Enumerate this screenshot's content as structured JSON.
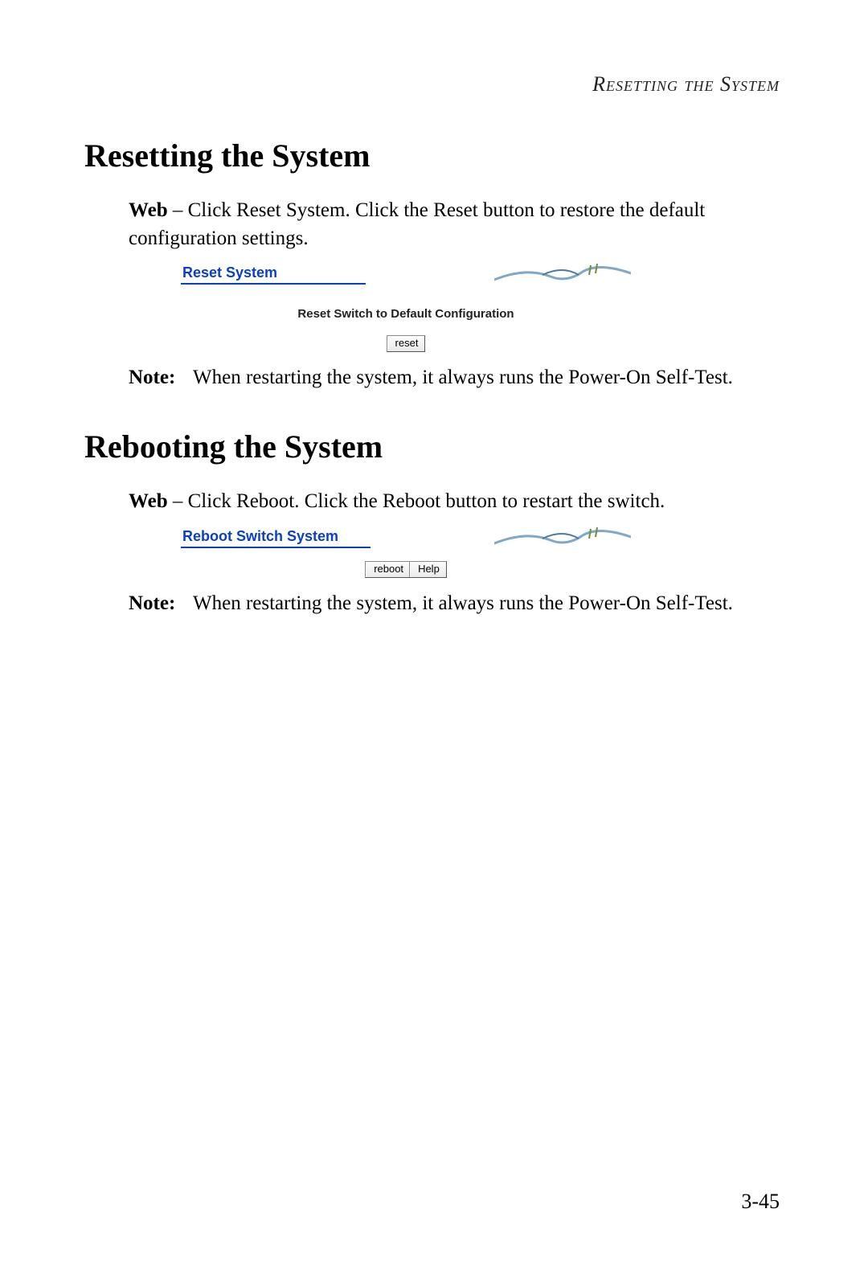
{
  "running_head": "Resetting the System",
  "page_number": "3-45",
  "section1": {
    "heading": "Resetting the System",
    "lead_bold": "Web",
    "lead_rest": " – Click Reset System. Click the Reset button to restore the default configuration settings.",
    "ui": {
      "title": "Reset System",
      "subhead": "Reset Switch to Default Configuration",
      "buttons": {
        "reset": "reset"
      }
    },
    "note_label": "Note:",
    "note_text": "When restarting the system, it always runs the Power-On Self-Test."
  },
  "section2": {
    "heading": "Rebooting the System",
    "lead_bold": "Web",
    "lead_rest": " – Click Reboot. Click the Reboot button to restart the switch.",
    "ui": {
      "title": "Reboot Switch System",
      "buttons": {
        "reboot": "reboot",
        "help": "Help"
      }
    },
    "note_label": "Note:",
    "note_text": "When restarting the system, it always runs the Power-On Self-Test."
  }
}
